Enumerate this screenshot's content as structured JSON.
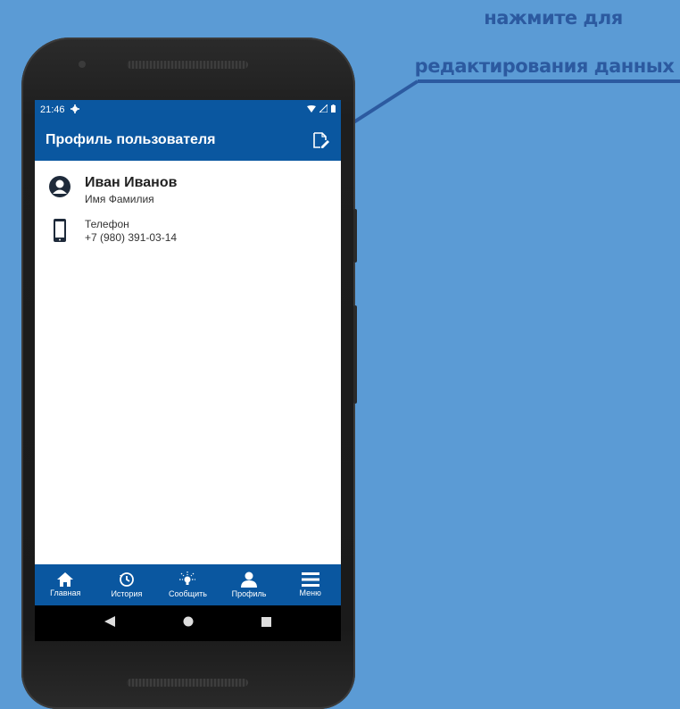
{
  "annotation": {
    "line1": "нажмите для",
    "line2": "редактирования данных"
  },
  "status_bar": {
    "time": "21:46"
  },
  "header": {
    "title": "Профиль пользователя",
    "edit_icon": "edit-icon"
  },
  "profile": {
    "name": "Иван Иванов",
    "name_caption": "Имя Фамилия",
    "phone_label": "Телефон",
    "phone_value": "+7 (980) 391-03-14"
  },
  "bottom_nav": {
    "items": [
      {
        "label": "Главная",
        "icon": "home-icon"
      },
      {
        "label": "История",
        "icon": "history-icon"
      },
      {
        "label": "Сообщить",
        "icon": "lightbulb-icon"
      },
      {
        "label": "Профиль",
        "icon": "person-icon"
      },
      {
        "label": "Меню",
        "icon": "menu-icon"
      }
    ]
  },
  "colors": {
    "background": "#5b9bd5",
    "primary": "#0a57a0",
    "callout_text": "#2c5aa0"
  }
}
